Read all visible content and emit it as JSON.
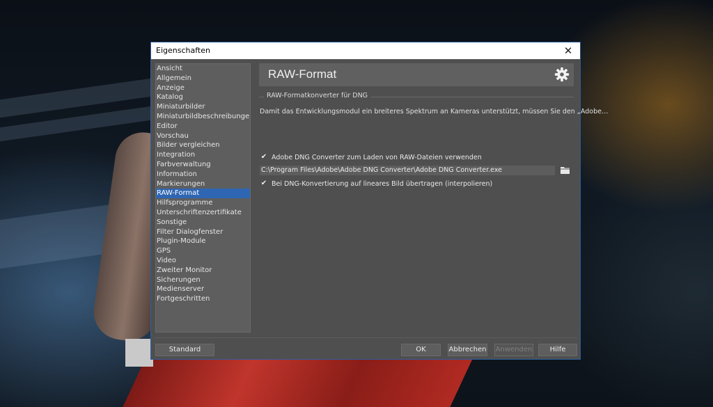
{
  "window": {
    "title": "Eigenschaften",
    "close_glyph": "✕"
  },
  "sidebar": {
    "items": [
      {
        "label": "Ansicht"
      },
      {
        "label": "Allgemein"
      },
      {
        "label": "Anzeige"
      },
      {
        "label": "Katalog"
      },
      {
        "label": "Miniaturbilder"
      },
      {
        "label": "Miniaturbildbeschreibungen"
      },
      {
        "label": "Editor"
      },
      {
        "label": "Vorschau"
      },
      {
        "label": "Bilder vergleichen"
      },
      {
        "label": "Integration"
      },
      {
        "label": "Farbverwaltung"
      },
      {
        "label": "Information"
      },
      {
        "label": "Markierungen"
      },
      {
        "label": "RAW-Format",
        "selected": true
      },
      {
        "label": "Hilfsprogramme"
      },
      {
        "label": "Unterschriftenzertifikate"
      },
      {
        "label": "Sonstige"
      },
      {
        "label": "Filter Dialogfenster"
      },
      {
        "label": "Plugin-Module"
      },
      {
        "label": "GPS"
      },
      {
        "label": "Video"
      },
      {
        "label": "Zweiter Monitor"
      },
      {
        "label": "Sicherungen"
      },
      {
        "label": "Medienserver"
      },
      {
        "label": "Fortgeschritten"
      }
    ]
  },
  "main": {
    "title": "RAW-Format",
    "settings_icon": "gear-icon",
    "group_title": "RAW-Formatkonverter für DNG",
    "description": "Damit das Entwicklungsmodul ein breiteres Spektrum an Kameras unterstützt, müssen Sie den „Adobe…",
    "use_dng": {
      "checked": true,
      "label": "Adobe DNG Converter zum Laden von RAW-Dateien verwenden"
    },
    "path_value": "C:\\Program Files\\Adobe\\Adobe DNG Converter\\Adobe DNG Converter.exe",
    "browse_icon": "folder-icon",
    "linear": {
      "checked": true,
      "label": "Bei DNG-Konvertierung auf lineares Bild übertragen (interpolieren)"
    },
    "check_glyph": "✔"
  },
  "footer": {
    "standard": "Standard",
    "ok": "OK",
    "cancel": "Abbrechen",
    "apply": "Anwenden",
    "help": "Hilfe"
  },
  "colors": {
    "selection": "#2f66b3",
    "panel": "#4f4f4f",
    "titlebar": "#ffffff"
  }
}
